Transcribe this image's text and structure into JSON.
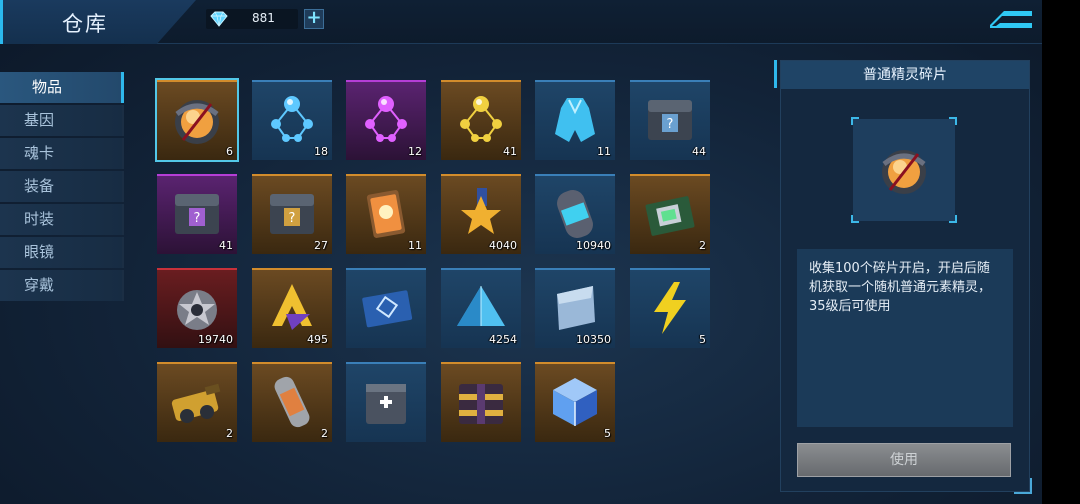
{
  "header": {
    "title": "仓库",
    "currency_value": "881",
    "plus_label": "+"
  },
  "menu": {
    "items": [
      {
        "label": "物品",
        "active": true
      },
      {
        "label": "基因",
        "active": false
      },
      {
        "label": "魂卡",
        "active": false
      },
      {
        "label": "装备",
        "active": false
      },
      {
        "label": "时装",
        "active": false
      },
      {
        "label": "眼镜",
        "active": false
      },
      {
        "label": "穿戴",
        "active": false
      }
    ]
  },
  "items": [
    {
      "name": "orb-fragment",
      "rarity": "gold",
      "count": "6",
      "selected": true,
      "icon": "orb-icon",
      "color": "#f0a040"
    },
    {
      "name": "blue-molecule",
      "rarity": "blue",
      "count": "18",
      "icon": "molecule-icon",
      "color": "#5ec8ff"
    },
    {
      "name": "purple-molecule",
      "rarity": "purple",
      "count": "12",
      "icon": "molecule-icon",
      "color": "#e060ff"
    },
    {
      "name": "gold-molecule",
      "rarity": "gold",
      "count": "41",
      "icon": "molecule-icon",
      "color": "#f0d040"
    },
    {
      "name": "blue-costume",
      "rarity": "blue",
      "count": "11",
      "icon": "costume-icon",
      "color": "#40c0f0"
    },
    {
      "name": "blue-chest",
      "rarity": "blue",
      "count": "44",
      "icon": "chest-icon",
      "color": "#6aa0d0"
    },
    {
      "name": "purple-chest",
      "rarity": "purple",
      "count": "41",
      "icon": "chest-icon",
      "color": "#a060d0"
    },
    {
      "name": "gold-chest",
      "rarity": "gold",
      "count": "27",
      "icon": "chest-icon",
      "color": "#d0a040"
    },
    {
      "name": "orange-card",
      "rarity": "gold",
      "count": "11",
      "icon": "card-icon",
      "color": "#f09040"
    },
    {
      "name": "star-medal",
      "rarity": "gold",
      "count": "4040",
      "icon": "star-icon",
      "color": "#f0b030"
    },
    {
      "name": "capsule",
      "rarity": "blue",
      "count": "10940",
      "icon": "capsule-icon",
      "color": "#40d0f0"
    },
    {
      "name": "chip-board",
      "rarity": "gold",
      "count": "2",
      "icon": "chip-icon",
      "color": "#60e090"
    },
    {
      "name": "silver-star-badge",
      "rarity": "red",
      "count": "19740",
      "icon": "badge-icon",
      "color": "#c8c8d0"
    },
    {
      "name": "gold-arrow-emblem",
      "rarity": "gold",
      "count": "495",
      "icon": "arrow-emblem-icon",
      "color": "#f0c030"
    },
    {
      "name": "blue-ticket",
      "rarity": "blue",
      "count": "",
      "icon": "ticket-icon",
      "color": "#3080d0"
    },
    {
      "name": "blue-pyramid",
      "rarity": "blue",
      "count": "4254",
      "icon": "pyramid-icon",
      "color": "#50c0f0"
    },
    {
      "name": "card-sheet",
      "rarity": "blue",
      "count": "10350",
      "icon": "sheet-icon",
      "color": "#9ab8d8"
    },
    {
      "name": "lightning-token",
      "rarity": "blue",
      "count": "5",
      "icon": "lightning-icon",
      "color": "#f0d020"
    },
    {
      "name": "gold-cannon",
      "rarity": "gold",
      "count": "2",
      "icon": "cannon-icon",
      "color": "#d0a030"
    },
    {
      "name": "orange-scroll",
      "rarity": "gold",
      "count": "2",
      "icon": "scroll-icon",
      "color": "#e08040"
    },
    {
      "name": "medkit-box",
      "rarity": "blue",
      "count": "",
      "icon": "medkit-icon",
      "color": "#7090b0"
    },
    {
      "name": "gold-crate",
      "rarity": "gold",
      "count": "",
      "icon": "crate-icon",
      "color": "#e0b040"
    },
    {
      "name": "crystal-cube",
      "rarity": "gold",
      "count": "5",
      "icon": "cube-icon",
      "color": "#60a0f0"
    }
  ],
  "detail": {
    "title": "普通精灵碎片",
    "description": "收集100个碎片开启，开启后随机获取一个随机普通元素精灵，35级后可使用",
    "use_label": "使用"
  }
}
